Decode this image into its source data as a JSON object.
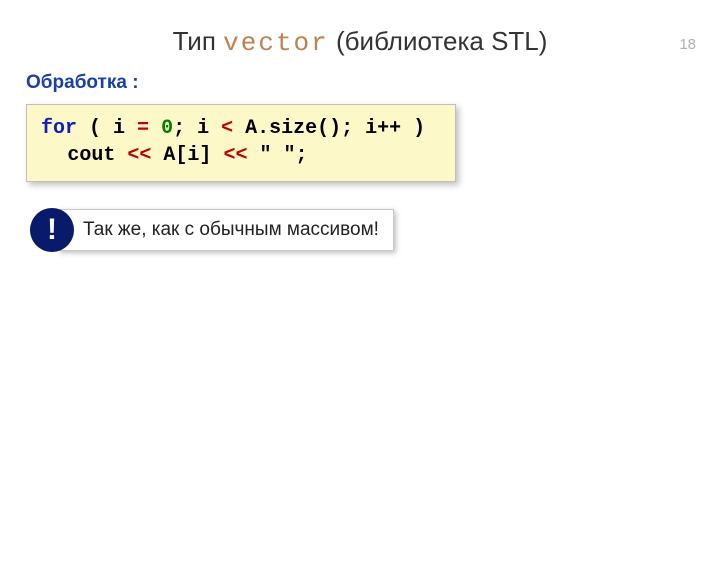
{
  "page_number": "18",
  "title": {
    "pre": "Тип ",
    "mono": "vector",
    "post": " (библиотека STL)"
  },
  "section_label": "Обработка :",
  "code": {
    "kw_for": "for",
    "sp_open": " ( i ",
    "eq1": "=",
    "sp1": " ",
    "zero": "0",
    "mid": "; i ",
    "lt": "<",
    "rest1": " A.size(); i++ )",
    "line2_a": "cout ",
    "ls1": "<<",
    "line2_b": " A[i] ",
    "ls2": "<<",
    "line2_c": " \" \";"
  },
  "bang": "!",
  "note_text": " Так же, как с обычным массивом!"
}
